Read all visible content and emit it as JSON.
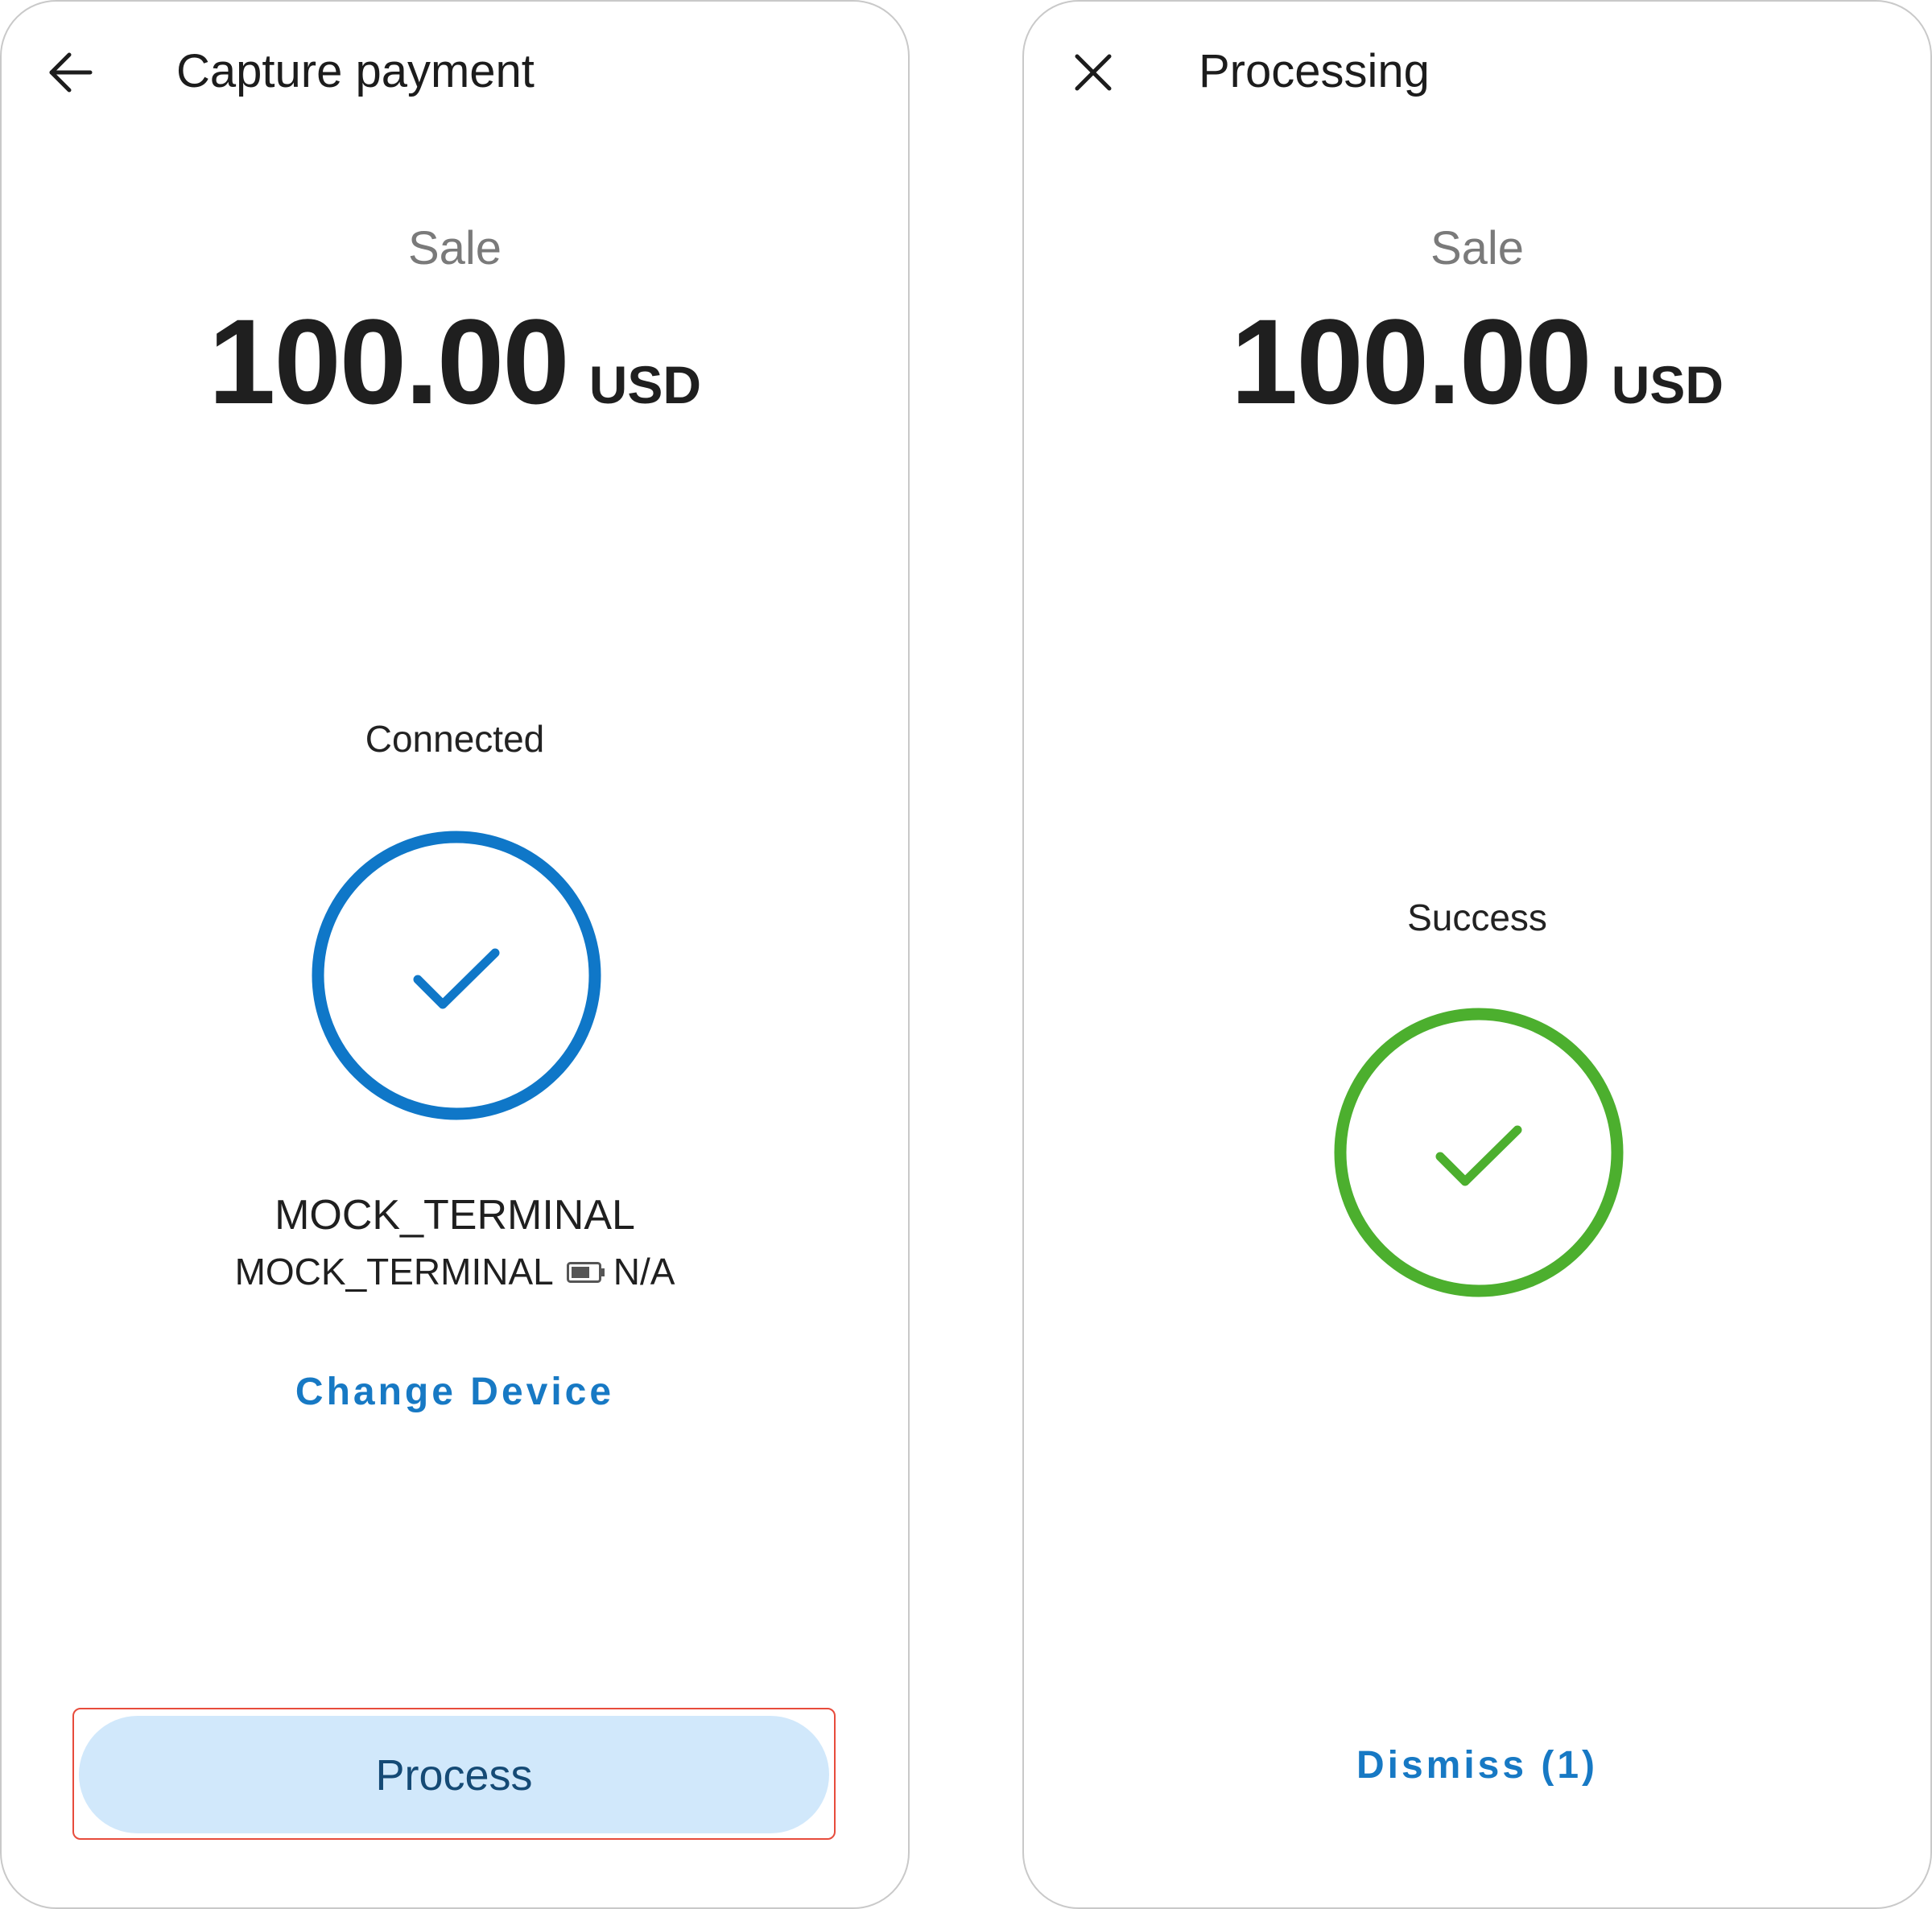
{
  "capture_screen": {
    "title": "Capture payment",
    "back_icon": "arrow-left-icon",
    "transaction_type": "Sale",
    "amount": "100.00",
    "currency": "USD",
    "status": "Connected",
    "status_icon": "check-circle-icon",
    "status_color": "#0f77c8",
    "device_name": "MOCK_TERMINAL",
    "device_model": "MOCK_TERMINAL",
    "battery_icon": "battery-icon",
    "battery_level": "N/A",
    "change_device_label": "Change Device",
    "process_label": "Process"
  },
  "processing_screen": {
    "title": "Processing",
    "close_icon": "close-icon",
    "transaction_type": "Sale",
    "amount": "100.00",
    "currency": "USD",
    "status": "Success",
    "status_icon": "check-circle-icon",
    "status_color": "#4caf2e",
    "dismiss_label": "Dismiss (1)"
  },
  "colors": {
    "link": "#1779c4",
    "button_bg": "#d1e8fb",
    "button_text": "#154a75",
    "highlight_outline": "#e74c3c"
  }
}
